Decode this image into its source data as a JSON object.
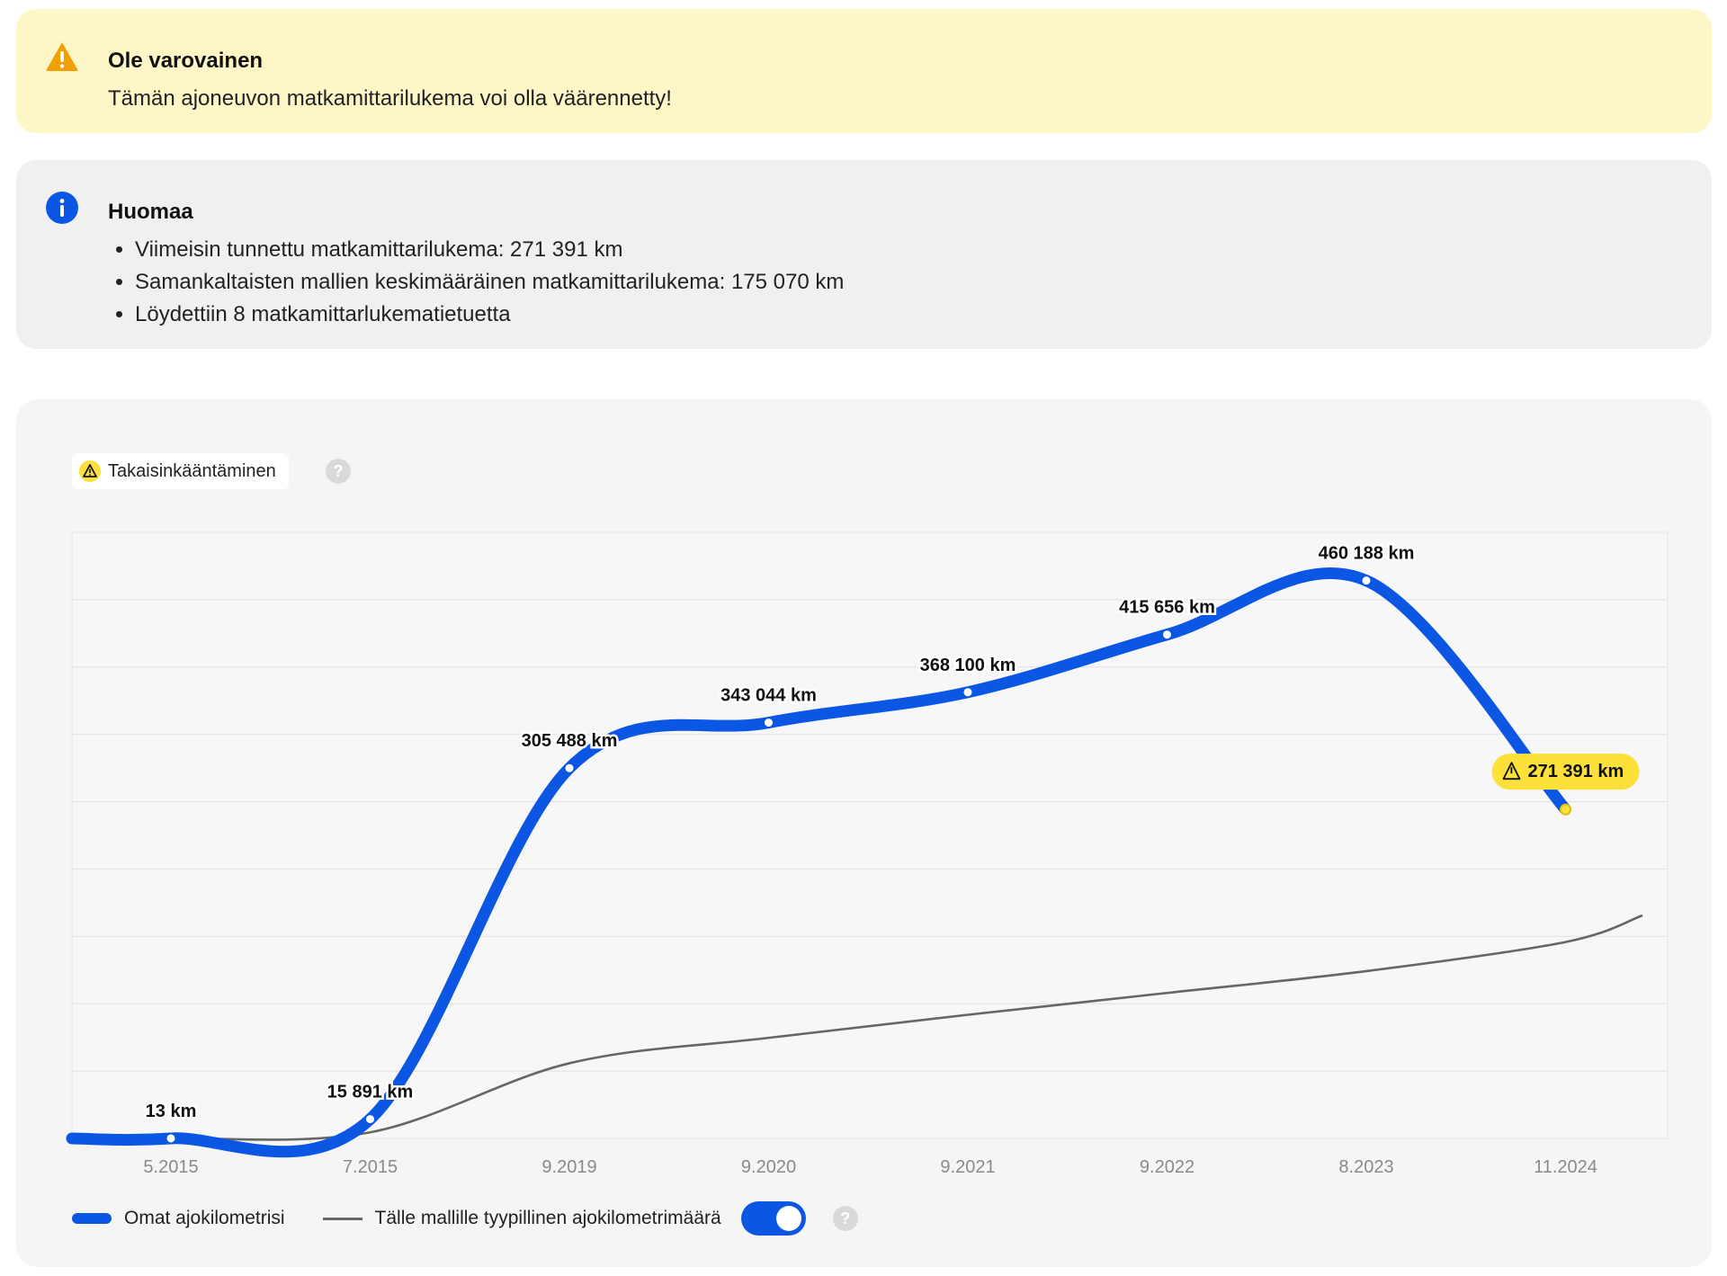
{
  "warning": {
    "title": "Ole varovainen",
    "text": "Tämän ajoneuvon matkamittarilukema voi olla väärennetty!",
    "icon": "warning-triangle-icon",
    "color": "#f0a000"
  },
  "info": {
    "title": "Huomaa",
    "icon": "info-icon",
    "color": "#0b57e3",
    "items": [
      "Viimeisin tunnettu matkamittarilukema: 271 391 km",
      "Samankaltaisten mallien keskimääräinen matkamittarilukema: 175 070 km",
      "Löydettiin 8 matkamittarlukematietuetta"
    ]
  },
  "badge": {
    "label": "Takaisinkääntäminen",
    "help": "?"
  },
  "legend": {
    "own_label": "Omat ajokilometrisi",
    "typical_label": "Tälle mallille tyypillinen ajokilometrimäärä",
    "typical_toggle_on": true,
    "help": "?"
  },
  "chart_data": {
    "type": "line",
    "categories": [
      "5.2015",
      "7.2015",
      "9.2019",
      "9.2020",
      "9.2021",
      "9.2022",
      "8.2023",
      "11.2024"
    ],
    "series": [
      {
        "name": "Omat ajokilometrisi",
        "color": "#0b57e3",
        "values": [
          13,
          15891,
          305488,
          343044,
          368100,
          415656,
          460188,
          271391
        ],
        "labels": [
          "13 km",
          "15 891 km",
          "305 488 km",
          "343 044 km",
          "368 100 km",
          "415 656 km",
          "460 188 km",
          "271 391 km"
        ],
        "flagged_index": 7
      },
      {
        "name": "Tälle mallille tyypillinen ajokilometrimäärä",
        "color": "#666666",
        "values": [
          0,
          5000,
          62000,
          83000,
          102000,
          120000,
          138000,
          162000
        ]
      }
    ],
    "ylim": [
      0,
      500000
    ],
    "grid": true,
    "flag_color": "#fde03a"
  }
}
